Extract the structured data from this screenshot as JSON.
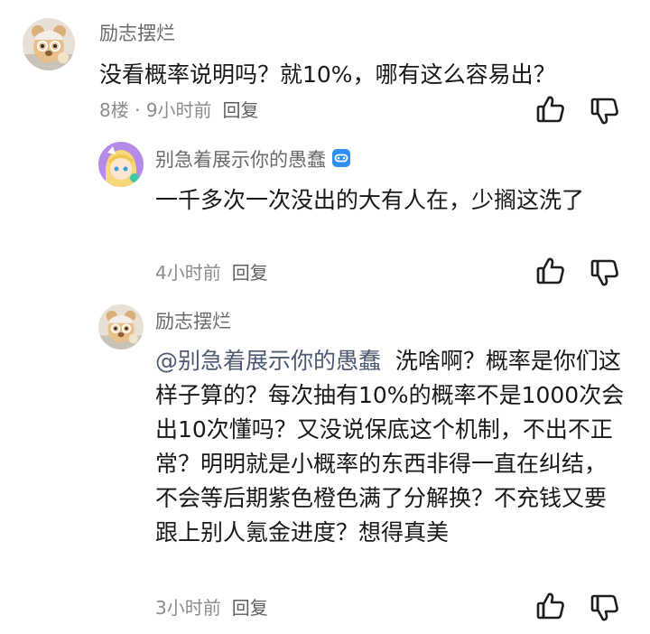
{
  "comments": [
    {
      "username": "励志摆烂",
      "content": "没看概率说明吗？就10%，哪有这么容易出？",
      "floor": "8楼",
      "separator": " · ",
      "time": "9小时前",
      "reply_label": "回复",
      "avatar_icon": "bear-avatar",
      "like_icon": "thumbs-up-icon",
      "dislike_icon": "thumbs-down-icon"
    },
    {
      "username": "别急着展示你的愚蠢",
      "badge_icon": "game-controller-badge",
      "badge_color": "#2f8ff2",
      "content": "一千多次一次没出的大有人在，少搁这洗了",
      "time": "4小时前",
      "reply_label": "回复",
      "avatar_icon": "anime-girl-avatar",
      "like_icon": "thumbs-up-icon",
      "dislike_icon": "thumbs-down-icon"
    },
    {
      "username": "励志摆烂",
      "mention": "@别急着展示你的愚蠢",
      "content": "洗啥啊？概率是你们这样子算的？每次抽有10%的概率不是1000次会出10次懂吗？又没说保底这个机制，不出不正常？明明就是小概率的东西非得一直在纠结，不会等后期紫色橙色满了分解换？不充钱又要跟上别人氪金进度？想得真美",
      "time": "3小时前",
      "reply_label": "回复",
      "avatar_icon": "bear-avatar",
      "like_icon": "thumbs-up-icon",
      "dislike_icon": "thumbs-down-icon"
    }
  ]
}
